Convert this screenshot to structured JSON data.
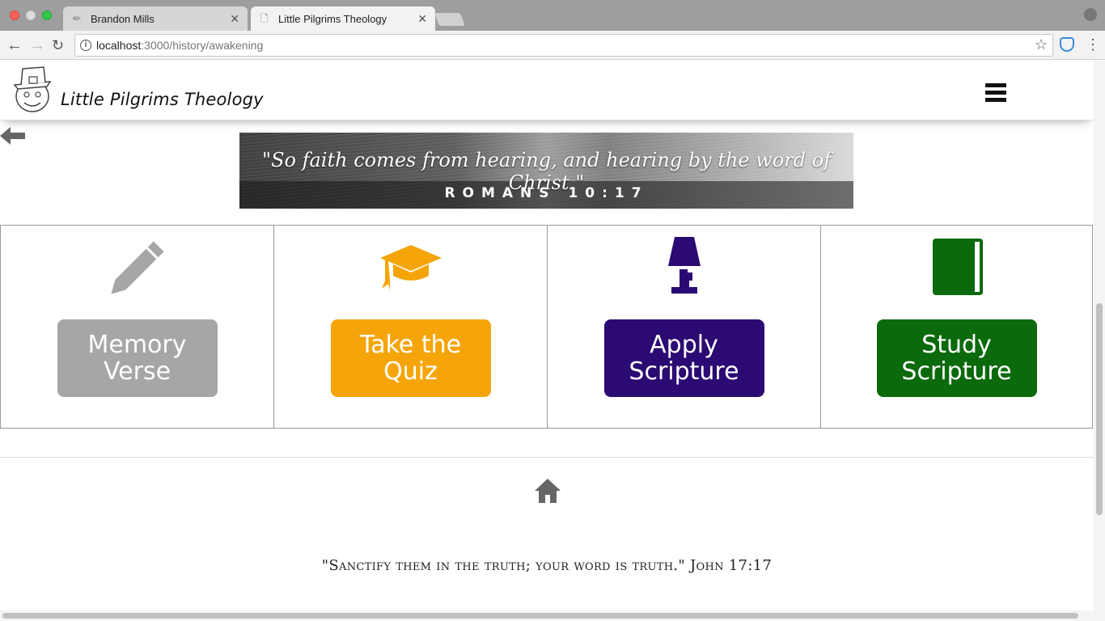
{
  "browser": {
    "tabs": [
      {
        "title": "Brandon Mills",
        "favicon": "pencil-icon"
      },
      {
        "title": "Little Pilgrims Theology",
        "favicon": "page-icon"
      }
    ],
    "url_host": "localhost",
    "url_path": ":3000/history/awakening"
  },
  "site": {
    "title": "Little Pilgrims Theology",
    "logo": "pilgrim-logo"
  },
  "banner": {
    "quote": "\"So faith comes from hearing, and hearing by the word of Christ.\"",
    "reference": "ROMANS 10:17"
  },
  "cards": [
    {
      "label": "Memory Verse",
      "icon": "pencil-icon",
      "color": "#a6a6a6"
    },
    {
      "label": "Take the Quiz",
      "icon": "graduation-cap-icon",
      "color": "#f5a50a"
    },
    {
      "label": "Apply Scripture",
      "icon": "lamp-icon",
      "color": "#2b0a73"
    },
    {
      "label": "Study Scripture",
      "icon": "book-icon",
      "color": "#0b6a0b"
    }
  ],
  "footer": {
    "quote": "\"Sanctify them in the truth; your word is truth.\" John 17:17"
  }
}
